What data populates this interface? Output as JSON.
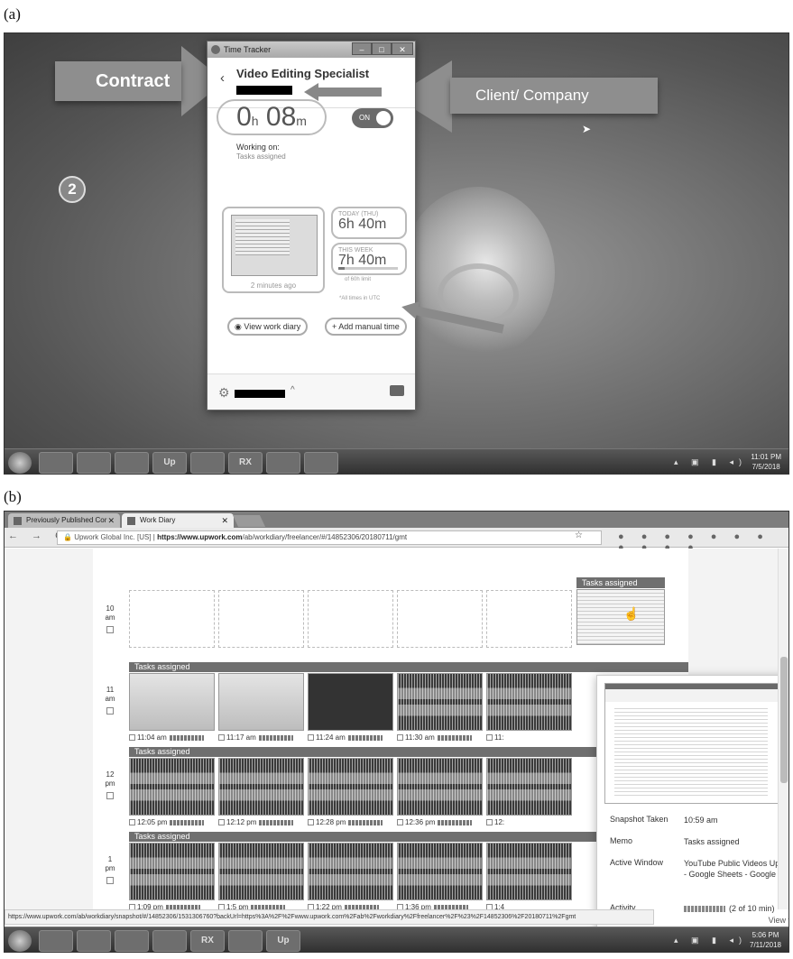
{
  "panel_a": {
    "label": "(a)",
    "annotations": {
      "contract": "Contract",
      "client": "Client/ Company",
      "step": "2"
    },
    "tracker": {
      "title": "Time Tracker",
      "contract_title": "Video Editing Specialist",
      "timer_h": "0",
      "timer_h_unit": "h",
      "timer_m": "08",
      "timer_m_unit": "m",
      "toggle": "ON",
      "working_on_label": "Working on:",
      "working_on_value": "Tasks assigned",
      "screenshot_caption": "2 minutes ago",
      "today_label": "TODAY (THU)",
      "today_value": "6h 40m",
      "week_label": "THIS WEEK",
      "week_value": "7h 40m",
      "week_progress": 0.13,
      "limit_text": "of 60h limit",
      "utc_note": "*All times in UTC",
      "view_diary": "View work diary",
      "add_manual": "Add manual time"
    },
    "taskbar": {
      "time": "11:01 PM",
      "date": "7/5/2018",
      "apps": [
        "",
        "",
        "",
        "Up",
        "",
        "RX",
        "",
        ""
      ]
    }
  },
  "panel_b": {
    "label": "(b)",
    "tabs": [
      {
        "title": "Previously Published Cor"
      },
      {
        "title": "Work Diary"
      }
    ],
    "address": {
      "org": "Upwork Global Inc. [US]",
      "url_bold": "https://www.upwork.com",
      "url_rest": "/ab/workdiary/freelancer/#/14852306/20180711/gmt"
    },
    "rows": [
      {
        "hour": "10",
        "ampm": "am",
        "header": "Tasks assigned",
        "cells": []
      },
      {
        "hour": "11",
        "ampm": "am",
        "header": "Tasks assigned",
        "cells": [
          {
            "time": "11:04 am"
          },
          {
            "time": "11:17 am"
          },
          {
            "time": "11:24 am"
          },
          {
            "time": "11:30 am"
          },
          {
            "time": "11:"
          }
        ]
      },
      {
        "hour": "12",
        "ampm": "pm",
        "header": "Tasks assigned",
        "cells": [
          {
            "time": "12:05 pm"
          },
          {
            "time": "12:12 pm"
          },
          {
            "time": "12:28 pm"
          },
          {
            "time": "12:36 pm"
          },
          {
            "time": "12:"
          }
        ]
      },
      {
        "hour": "1",
        "ampm": "pm",
        "header": "Tasks assigned",
        "cells": [
          {
            "time": "1:09 pm"
          },
          {
            "time": "1:5 pm"
          },
          {
            "time": "1:22 pm"
          },
          {
            "time": "1:36 pm"
          },
          {
            "time": "1:4"
          }
        ]
      }
    ],
    "popover": {
      "snapshot_taken_label": "Snapshot Taken",
      "snapshot_taken": "10:59 am",
      "memo_label": "Memo",
      "memo": "Tasks assigned",
      "active_window_label": "Active Window",
      "active_window": "YouTube Public Videos Updated List - Google Sheets - Google Chrome",
      "activity_label": "Activity",
      "activity": "(2 of 10 min)",
      "link": "View full-size"
    },
    "status_url": "https://www.upwork.com/ab/workdiary/snapshot/#/14852306/1531306760?backUrl=https%3A%2F%2Fwww.upwork.com%2Fab%2Fworkdiary%2Ffreelancer%2F%23%2F14852306%2F20180711%2Fgmt",
    "taskbar": {
      "time": "5:06 PM",
      "date": "7/11/2018",
      "apps": [
        "",
        "",
        "",
        "",
        "",
        "RX",
        "",
        "Up"
      ]
    }
  }
}
